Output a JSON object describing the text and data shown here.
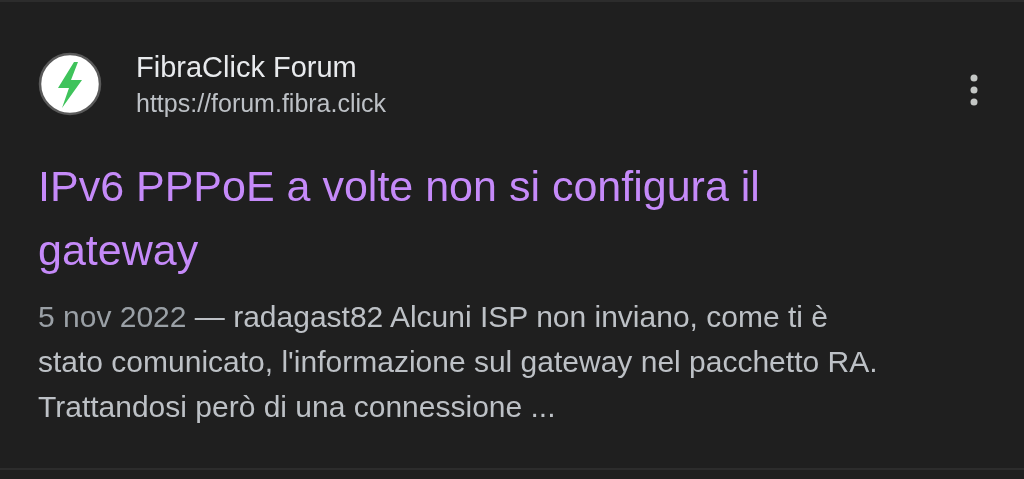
{
  "result": {
    "site_name": "FibraClick Forum",
    "url": "https://forum.fibra.click",
    "title": "IPv6 PPPoE a volte non si configura il gateway",
    "date": "5 nov 2022",
    "snippet": "— radagast82 Alcuni ISP non inviano, come ti è stato comunicato, l'informazione sul gateway nel pacchetto RA. Trattandosi però di una connessione ..."
  }
}
